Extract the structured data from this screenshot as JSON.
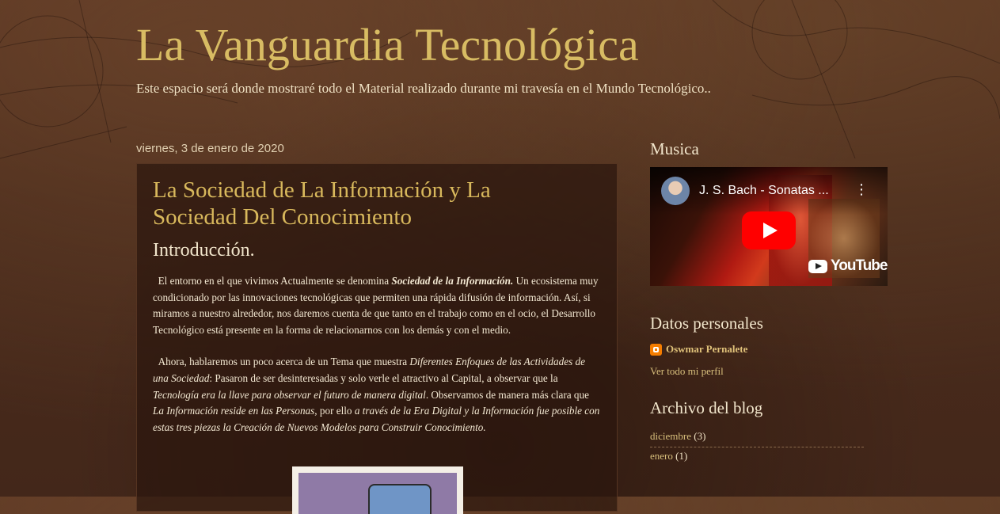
{
  "header": {
    "title": "La Vanguardia Tecnológica",
    "description": "Este espacio será donde mostraré todo el Material realizado durante mi travesía en el Mundo Tecnológico.."
  },
  "post": {
    "date": "viernes, 3 de enero de 2020",
    "title": "La Sociedad de La Información y La Sociedad Del Conocimiento",
    "subheading": "Introducción.",
    "p1": {
      "a": "El entorno en el que vivimos Actualmente se denomina ",
      "b": "Sociedad de la Información.",
      "c": " Un ecosistema muy condicionado por las innovaciones tecnológicas que permiten una rápida difusión de información. Así, si miramos a nuestro alrededor, nos daremos cuenta de que tanto en el trabajo como en el ocio, el Desarrollo Tecnológico está presente en la forma de relacionarnos con los demás y con el medio."
    },
    "p2": {
      "a": "Ahora, hablaremos un poco acerca de un Tema que muestra ",
      "b": "Diferentes Enfoques de las Actividades de una Sociedad",
      "c": ": Pasaron de ser desinteresadas y solo verle el atractivo al Capital, a observar que la ",
      "d": "Tecnología era la llave para observar el futuro de manera digital",
      "e": ". Observamos de manera más clara que ",
      "f": "La Información reside en las Personas",
      "g": ", por ello ",
      "h": "a través de la Era Digital y la Información fue posible con estas tres piezas la Creación de Nuevos Modelos para Construir Conocimiento."
    }
  },
  "sidebar": {
    "music": {
      "title": "Musica",
      "video_title": "J. S. Bach - Sonatas ...",
      "menu_icon": "⋮",
      "youtube_label": "YouTube"
    },
    "profile": {
      "title": "Datos personales",
      "name": "Oswmar Pernalete",
      "link": "Ver todo mi perfil"
    },
    "archive": {
      "title": "Archivo del blog",
      "items": [
        {
          "label": "diciembre",
          "count": "(3)"
        },
        {
          "label": "enero",
          "count": "(1)"
        }
      ]
    }
  },
  "colors": {
    "title": "#d8bc63",
    "link": "#d8bf7c",
    "background": "#4a2b1c"
  }
}
